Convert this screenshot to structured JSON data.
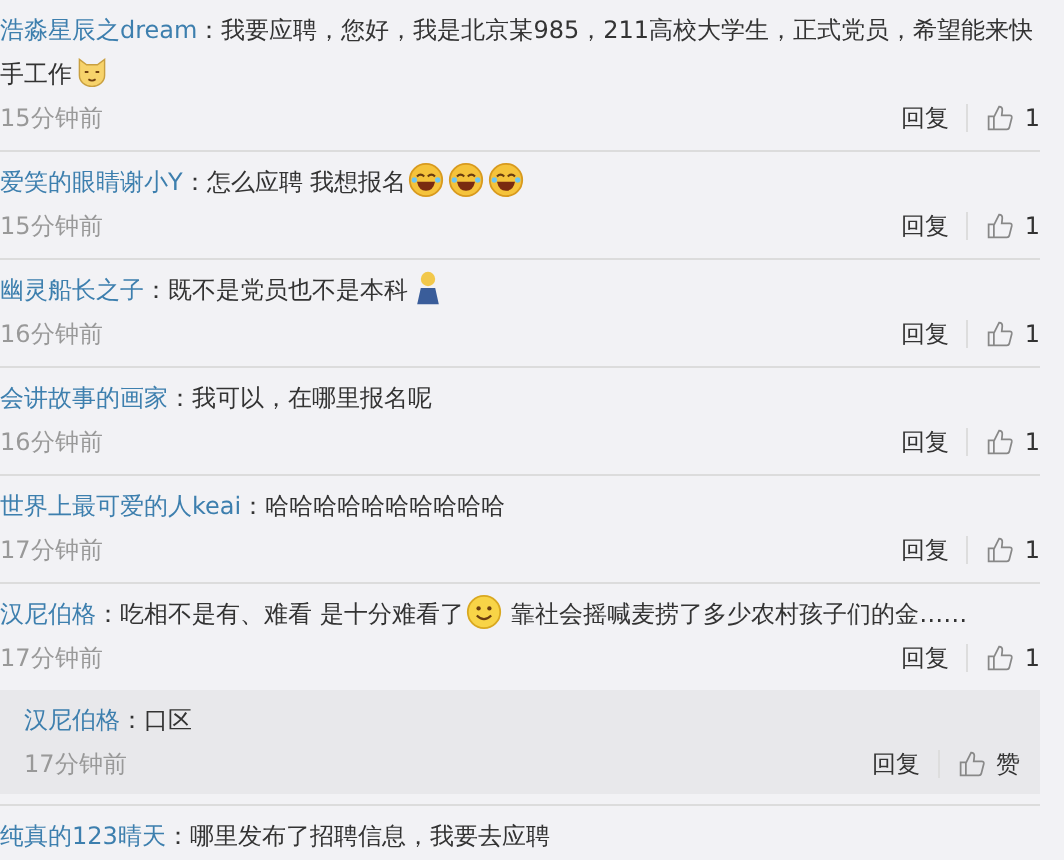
{
  "separator": "：",
  "comments": [
    {
      "user": "浩淼星辰之dream",
      "content": [
        {
          "kind": "text",
          "text": "我要应聘，您好，我是北京某985，211高校大学生，正式党员，希望能来快手工作"
        },
        {
          "kind": "cat"
        }
      ],
      "time": "15分钟前",
      "reply_label": "回复",
      "likes": "1"
    },
    {
      "user": "爱笑的眼睛谢小Y",
      "content": [
        {
          "kind": "text",
          "text": "怎么应聘 我想报名"
        },
        {
          "kind": "laugh"
        },
        {
          "kind": "laugh"
        },
        {
          "kind": "laugh"
        }
      ],
      "time": "15分钟前",
      "reply_label": "回复",
      "likes": "1"
    },
    {
      "user": "幽灵船长之子",
      "content": [
        {
          "kind": "text",
          "text": "既不是党员也不是本科"
        },
        {
          "kind": "figure"
        }
      ],
      "time": "16分钟前",
      "reply_label": "回复",
      "likes": "1"
    },
    {
      "user": "会讲故事的画家",
      "content": [
        {
          "kind": "text",
          "text": "我可以，在哪里报名呢"
        }
      ],
      "time": "16分钟前",
      "reply_label": "回复",
      "likes": "1"
    },
    {
      "user": "世界上最可爱的人keai",
      "content": [
        {
          "kind": "text",
          "text": "哈哈哈哈哈哈哈哈哈哈"
        }
      ],
      "time": "17分钟前",
      "reply_label": "回复",
      "likes": "1"
    },
    {
      "user": "汉尼伯格",
      "content": [
        {
          "kind": "text",
          "text": "吃相不是有、难看 是十分难看了"
        },
        {
          "kind": "smile"
        },
        {
          "kind": "text",
          "text": " 靠社会摇喊麦捞了多少农村孩子们的金……"
        }
      ],
      "time": "17分钟前",
      "reply_label": "回复",
      "likes": "1",
      "replies": [
        {
          "user": "汉尼伯格",
          "content": [
            {
              "kind": "text",
              "text": "口区"
            }
          ],
          "time": "17分钟前",
          "reply_label": "回复",
          "likes": "赞"
        }
      ]
    },
    {
      "user": "纯真的123晴天",
      "content": [
        {
          "kind": "text",
          "text": "哪里发布了招聘信息，我要去应聘"
        }
      ]
    }
  ]
}
